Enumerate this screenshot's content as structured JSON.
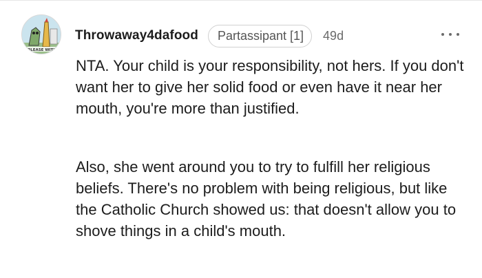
{
  "comment": {
    "username": "Throwaway4dafood",
    "flair": "Partassipant [1]",
    "age": "49d",
    "avatar_text": "PLEASE WITH",
    "paragraphs": [
      "NTA. Your child is your responsibility, not hers. If you don't want her to give her solid food or even have it near her mouth, you're more than justified.",
      "Also, she went around you to try to fulfill her religious beliefs. There's no problem with being religious, but like the Catholic Church showed us: that doesn't allow you to shove things in a child's mouth."
    ]
  },
  "icons": {
    "more": "more-options-icon"
  },
  "colors": {
    "text": "#1c1c1c",
    "muted": "#6a6a6a",
    "flair_border": "#d0d0d0"
  }
}
